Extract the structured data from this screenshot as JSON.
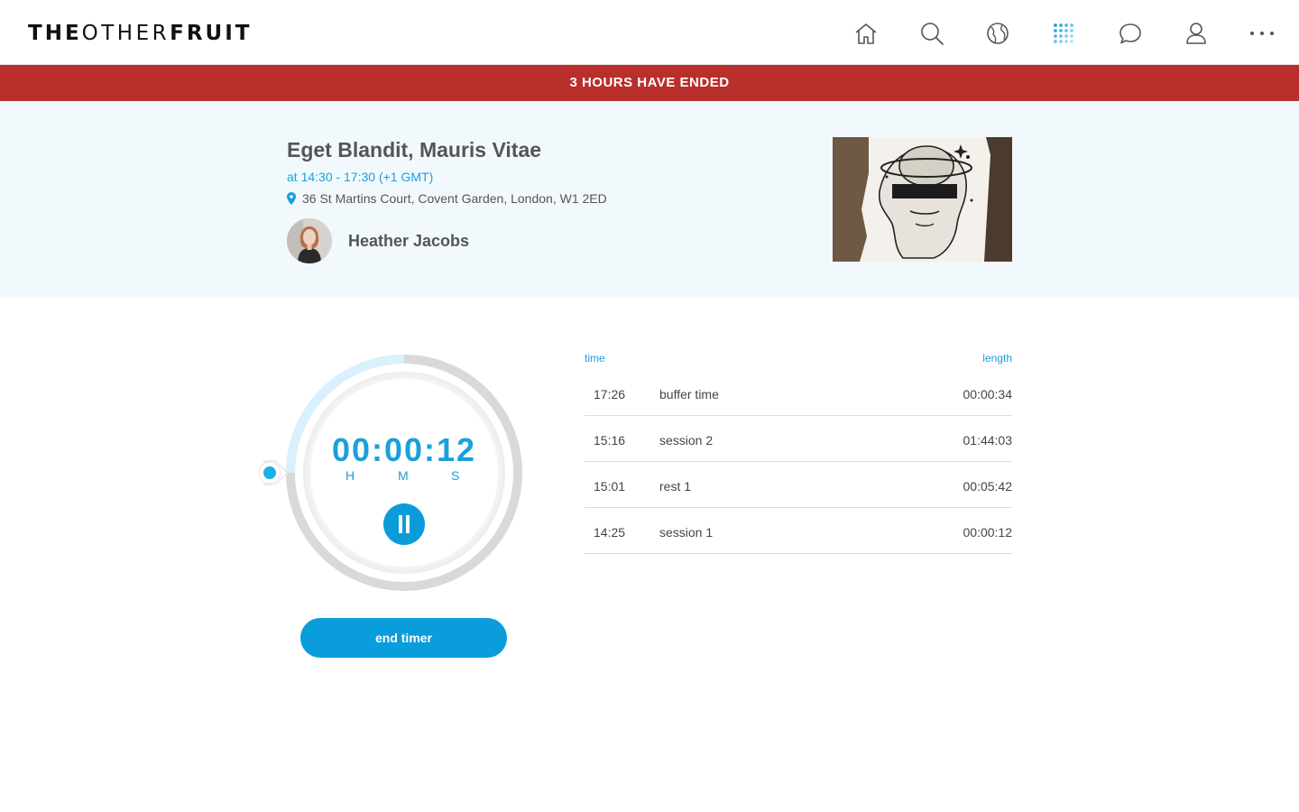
{
  "header": {
    "logo": {
      "part1": "THE",
      "part2": "OTHER",
      "part3": "FRUIT"
    },
    "nav": [
      "home-icon",
      "search-icon",
      "globe-icon",
      "apps-grid-icon",
      "chat-icon",
      "user-icon",
      "more-icon"
    ],
    "active_nav": "apps-grid-icon",
    "accent": "#1aa0db"
  },
  "banner": {
    "text": "3 HOURS HAVE ENDED",
    "color": "#b92f2c"
  },
  "event": {
    "title": "Eget Blandit, Mauris Vitae",
    "time": "at 14:30 - 17:30 (+1 GMT)",
    "address": "36 St Martins Court, Covent Garden, London, W1 2ED",
    "host": "Heather Jacobs"
  },
  "timer": {
    "display": "00:00:12",
    "units": {
      "h": "H",
      "m": "M",
      "s": "S"
    },
    "end_label": "end timer"
  },
  "log": {
    "col_time": "time",
    "col_length": "length",
    "rows": [
      {
        "time": "17:26",
        "name": "buffer time",
        "length": "00:00:34"
      },
      {
        "time": "15:16",
        "name": "session 2",
        "length": "01:44:03"
      },
      {
        "time": "15:01",
        "name": "rest 1",
        "length": "00:05:42"
      },
      {
        "time": "14:25",
        "name": "session 1",
        "length": "00:00:12"
      }
    ]
  }
}
